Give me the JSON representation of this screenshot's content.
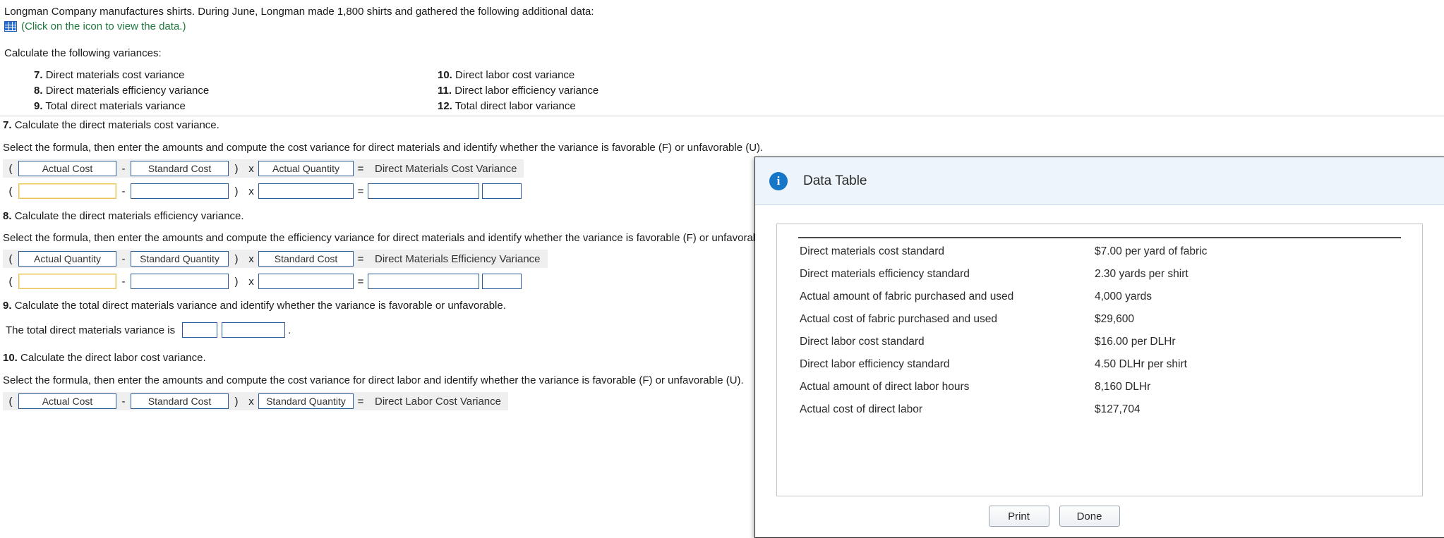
{
  "problem": {
    "intro": "Longman Company manufactures shirts. During June, Longman made 1,800 shirts and gathered the following additional data:",
    "data_link": "(Click on the icon to view the data.)",
    "calc_header": "Calculate the following variances:",
    "variances_left": [
      {
        "num": "7.",
        "text": "Direct materials cost variance"
      },
      {
        "num": "8.",
        "text": "Direct materials efficiency variance"
      },
      {
        "num": "9.",
        "text": "Total direct materials variance"
      }
    ],
    "variances_right": [
      {
        "num": "10.",
        "text": "Direct labor cost variance"
      },
      {
        "num": "11.",
        "text": "Direct labor efficiency variance"
      },
      {
        "num": "12.",
        "text": "Total direct labor variance"
      }
    ]
  },
  "q7": {
    "num": "7.",
    "title": "Calculate the direct materials cost variance.",
    "instruction": "Select the formula, then enter the amounts and compute the cost variance for direct materials and identify whether the variance is favorable (F) or unfavorable (U).",
    "open_paren": "(",
    "close_paren": ")",
    "minus": "-",
    "times": "x",
    "equals": "=",
    "term1": "Actual Cost",
    "term2": "Standard Cost",
    "term3": "Actual Quantity",
    "result_label": "Direct Materials Cost Variance"
  },
  "q8": {
    "num": "8.",
    "title": "Calculate the direct materials efficiency variance.",
    "instruction": "Select the formula, then enter the amounts and compute the efficiency variance for direct materials and identify whether the variance is favorable (F) or unfavorable (U).",
    "open_paren": "(",
    "close_paren": ")",
    "minus": "-",
    "times": "x",
    "equals": "=",
    "term1": "Actual Quantity",
    "term2": "Standard Quantity",
    "term3": "Standard Cost",
    "result_label": "Direct Materials Efficiency Variance"
  },
  "q9": {
    "num": "9.",
    "title": "Calculate the total direct materials variance and identify whether the variance is favorable or unfavorable.",
    "answer_prefix": "The total direct materials variance is",
    "period": "."
  },
  "q10": {
    "num": "10.",
    "title": "Calculate the direct labor cost variance.",
    "instruction": "Select the formula, then enter the amounts and compute the cost variance for direct labor and identify whether the variance is favorable (F) or unfavorable (U).",
    "open_paren": "(",
    "close_paren": ")",
    "minus": "-",
    "times": "x",
    "equals": "=",
    "term1": "Actual Cost",
    "term2": "Standard Cost",
    "term3": "Standard Quantity",
    "result_label": "Direct Labor Cost Variance"
  },
  "dialog": {
    "title": "Data Table",
    "rows": [
      {
        "label": "Direct materials cost standard",
        "value": "$7.00 per yard of fabric"
      },
      {
        "label": "Direct materials efficiency standard",
        "value": "2.30 yards per shirt"
      },
      {
        "label": "Actual amount of fabric purchased and used",
        "value": "4,000 yards"
      },
      {
        "label": "Actual cost of fabric purchased and used",
        "value": "$29,600"
      },
      {
        "label": "Direct labor cost standard",
        "value": "$16.00 per DLHr"
      },
      {
        "label": "Direct labor efficiency standard",
        "value": "4.50 DLHr per shirt"
      },
      {
        "label": "Actual amount of direct labor hours",
        "value": "8,160 DLHr"
      },
      {
        "label": "Actual cost of direct labor",
        "value": "$127,704"
      }
    ],
    "print_label": "Print",
    "done_label": "Done"
  },
  "colors": {
    "link": "#1f7a3d",
    "field_border": "#2e5c9a",
    "active_field": "#e8c55a",
    "dialog_header": "#eef4fb",
    "info_blue": "#1676c8"
  }
}
